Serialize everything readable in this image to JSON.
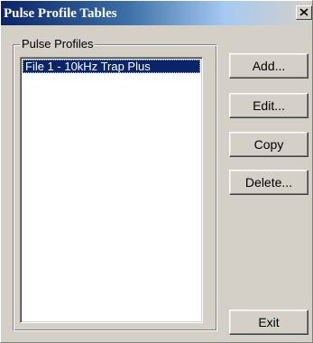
{
  "window": {
    "title": "Pulse Profile Tables",
    "close_symbol": "×"
  },
  "group": {
    "label": "Pulse Profiles"
  },
  "list": {
    "items": [
      {
        "label": "File 1 - 10kHz Trap Plus",
        "selected": true
      }
    ]
  },
  "buttons": {
    "add": "Add...",
    "edit": "Edit...",
    "copy": "Copy",
    "delete": "Delete...",
    "exit": "Exit"
  },
  "icons": {
    "close": "close-icon"
  },
  "colors": {
    "titlebar_start": "#0a246a",
    "titlebar_end": "#d4d0c8",
    "face": "#d4d0c8",
    "selection": "#0a246a"
  }
}
